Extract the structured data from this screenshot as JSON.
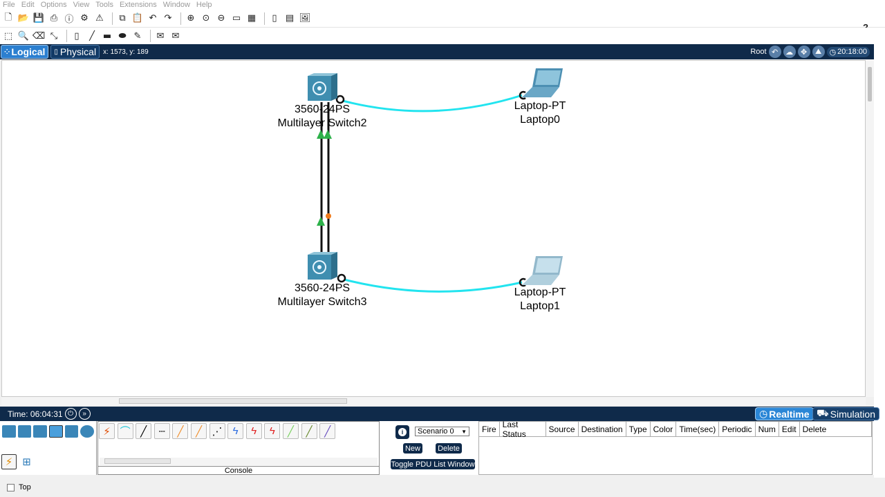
{
  "menu": [
    "File",
    "Edit",
    "Options",
    "View",
    "Tools",
    "Extensions",
    "Window",
    "Help"
  ],
  "toolbar_help": "?",
  "nav": {
    "logical": "Logical",
    "physical": "Physical",
    "coords": "x: 1573, y: 189",
    "root": "Root",
    "clock": "20:18:00"
  },
  "devices": {
    "switch2": {
      "model": "3560-24PS",
      "name": "Multilayer Switch2"
    },
    "switch3": {
      "model": "3560-24PS",
      "name": "Multilayer Switch3"
    },
    "laptop0": {
      "model": "Laptop-PT",
      "name": "Laptop0"
    },
    "laptop1": {
      "model": "Laptop-PT",
      "name": "Laptop1"
    }
  },
  "timebar": {
    "time": "Time: 06:04:31",
    "realtime": "Realtime",
    "simulation": "Simulation"
  },
  "bottom": {
    "console": "Console",
    "scenario": "Scenario 0",
    "new_btn": "New",
    "delete_btn": "Delete",
    "toggle_btn": "Toggle PDU List Window",
    "pdu_columns": [
      "Fire",
      "Last Status",
      "Source",
      "Destination",
      "Type",
      "Color",
      "Time(sec)",
      "Periodic",
      "Num",
      "Edit",
      "Delete"
    ]
  },
  "status": {
    "top_label": "Top"
  },
  "colors": {
    "nav_bg": "#0f2a4a",
    "cable_cyan": "#22e4ef",
    "link_up": "#2db14a",
    "link_wait": "#f07b1c"
  }
}
